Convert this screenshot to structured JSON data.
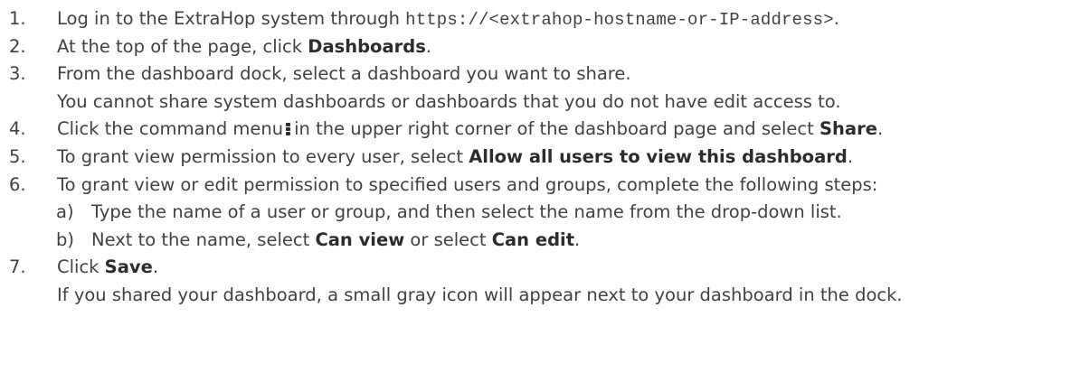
{
  "steps": [
    {
      "num": "1.",
      "pre": "Log in to the ExtraHop system through ",
      "code": "https://<extrahop-hostname-or-IP-address>",
      "post": "."
    },
    {
      "num": "2.",
      "pre": "At the top of the page, click ",
      "bold": "Dashboards",
      "post": "."
    },
    {
      "num": "3.",
      "text": "From the dashboard dock, select a dashboard you want to share."
    },
    {
      "note": "You cannot share system dashboards or dashboards that you do not have edit access to."
    },
    {
      "num": "4.",
      "pre": "Click the command menu",
      "icon": "vertical-ellipsis-icon",
      "mid": "in the upper right corner of the dashboard page and select ",
      "bold": "Share",
      "post": "."
    },
    {
      "num": "5.",
      "pre": "To grant view permission to every user, select ",
      "bold": "Allow all users to view this dashboard",
      "post": "."
    },
    {
      "num": "6.",
      "text": "To grant view or edit permission to specified users and groups, complete the following steps:"
    },
    {
      "letter": "a)",
      "text": "Type the name of a user or group, and then select the name from the drop-down list."
    },
    {
      "letter": "b)",
      "pre": "Next to the name, select ",
      "bold1": "Can view",
      "mid": " or select ",
      "bold2": "Can edit",
      "post": "."
    },
    {
      "num": "7.",
      "pre": "Click ",
      "bold": "Save",
      "post": "."
    },
    {
      "note": "If you shared your dashboard, a small gray icon will appear next to your dashboard in the dock."
    }
  ]
}
